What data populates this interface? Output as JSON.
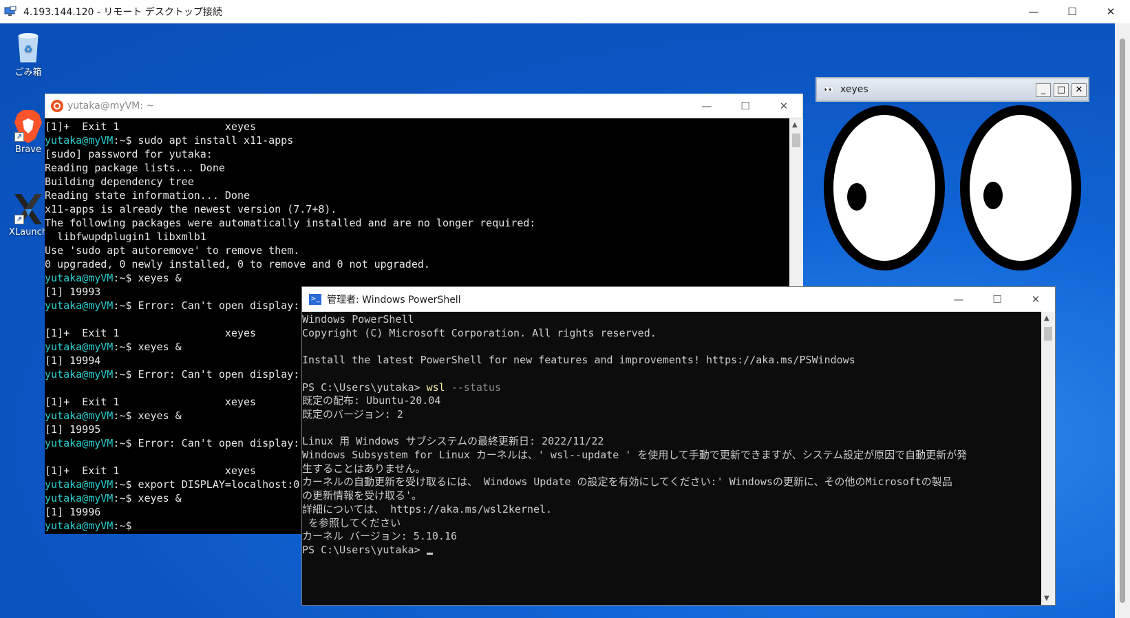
{
  "rdp": {
    "title": "4.193.144.120 - リモート デスクトップ接続",
    "minimize": "—",
    "maximize": "☐",
    "close": "✕"
  },
  "desktop_icons": [
    {
      "label": "ごみ箱",
      "icon": "recycle-bin-icon"
    },
    {
      "label": "Brave",
      "icon": "brave-browser-icon"
    },
    {
      "label": "XLaunch",
      "icon": "xlaunch-icon"
    }
  ],
  "ubuntu_terminal": {
    "title": "yutaka@myVM: ~",
    "prompt_user": "yutaka@myVM",
    "prompt_suffix": ":~$",
    "lines": [
      {
        "t": "out",
        "text": "[1]+  Exit 1                 xeyes"
      },
      {
        "t": "cmd",
        "text": " sudo apt install x11-apps"
      },
      {
        "t": "out",
        "text": "[sudo] password for yutaka:"
      },
      {
        "t": "out",
        "text": "Reading package lists... Done"
      },
      {
        "t": "out",
        "text": "Building dependency tree"
      },
      {
        "t": "out",
        "text": "Reading state information... Done"
      },
      {
        "t": "out",
        "text": "x11-apps is already the newest version (7.7+8)."
      },
      {
        "t": "out",
        "text": "The following packages were automatically installed and are no longer required:"
      },
      {
        "t": "out",
        "text": "  libfwupdplugin1 libxmlb1"
      },
      {
        "t": "out",
        "text": "Use 'sudo apt autoremove' to remove them."
      },
      {
        "t": "out",
        "text": "0 upgraded, 0 newly installed, 0 to remove and 0 not upgraded."
      },
      {
        "t": "cmd",
        "text": " xeyes &"
      },
      {
        "t": "out",
        "text": "[1] 19993"
      },
      {
        "t": "cmd",
        "text": " Error: Can't open display:"
      },
      {
        "t": "out",
        "text": ""
      },
      {
        "t": "out",
        "text": "[1]+  Exit 1                 xeyes"
      },
      {
        "t": "cmd",
        "text": " xeyes &"
      },
      {
        "t": "out",
        "text": "[1] 19994"
      },
      {
        "t": "cmd",
        "text": " Error: Can't open display:"
      },
      {
        "t": "out",
        "text": ""
      },
      {
        "t": "out",
        "text": "[1]+  Exit 1                 xeyes"
      },
      {
        "t": "cmd",
        "text": " xeyes &"
      },
      {
        "t": "out",
        "text": "[1] 19995"
      },
      {
        "t": "cmd",
        "text": " Error: Can't open display:"
      },
      {
        "t": "out",
        "text": ""
      },
      {
        "t": "out",
        "text": "[1]+  Exit 1                 xeyes"
      },
      {
        "t": "cmd",
        "text": " export DISPLAY=localhost:0"
      },
      {
        "t": "cmd",
        "text": " xeyes &"
      },
      {
        "t": "out",
        "text": "[1] 19996"
      },
      {
        "t": "cmd",
        "text": ""
      }
    ]
  },
  "xeyes": {
    "title": "xeyes",
    "icon": "xeyes-eyes-icon",
    "minimize": "_",
    "maximize": "□",
    "close": "✕"
  },
  "powershell": {
    "title": "管理者: Windows PowerShell",
    "lines": [
      {
        "t": "out",
        "text": "Windows PowerShell"
      },
      {
        "t": "out",
        "text": "Copyright (C) Microsoft Corporation. All rights reserved."
      },
      {
        "t": "out",
        "text": ""
      },
      {
        "t": "out",
        "text": "Install the latest PowerShell for new features and improvements! https://aka.ms/PSWindows"
      },
      {
        "t": "out",
        "text": ""
      },
      {
        "t": "cmd",
        "prompt": "PS C:\\Users\\yutaka> ",
        "cmd": "wsl",
        "arg": " --status"
      },
      {
        "t": "out",
        "text": "既定の配布: Ubuntu-20.04"
      },
      {
        "t": "out",
        "text": "既定のバージョン: 2"
      },
      {
        "t": "out",
        "text": ""
      },
      {
        "t": "out",
        "text": "Linux 用 Windows サブシステムの最終更新日: 2022/11/22"
      },
      {
        "t": "out",
        "text": "Windows Subsystem for Linux カーネルは、' wsl--update ' を使用して手動で更新できますが、システム設定が原因で自動更新が発"
      },
      {
        "t": "out",
        "text": "生することはありません。"
      },
      {
        "t": "out",
        "text": "カーネルの自動更新を受け取るには、 Windows Update の設定を有効にしてください:' Windowsの更新に、その他のMicrosoftの製品"
      },
      {
        "t": "out",
        "text": "の更新情報を受け取る'。"
      },
      {
        "t": "out",
        "text": "詳細については、 https://aka.ms/wsl2kernel."
      },
      {
        "t": "out",
        "text": " を参照してください"
      },
      {
        "t": "out",
        "text": "カーネル バージョン: 5.10.16"
      },
      {
        "t": "prompt",
        "prompt": "PS C:\\Users\\yutaka> "
      }
    ]
  },
  "colors": {
    "desktop_blue": "#0b55c2",
    "prompt_cyan": "#2bd0d0",
    "ps_command_yellow": "#f9f1a5",
    "ubuntu_orange": "#e95420"
  }
}
